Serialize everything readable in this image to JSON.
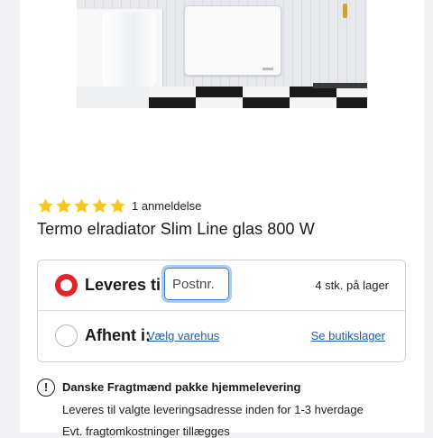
{
  "product": {
    "image_alt": "Termo elradiator Slim Line glas 800 W product photo",
    "rating_stars": 5,
    "review_count": "1 anmeldelse",
    "title": "Termo elradiator Slim Line glas 800 W"
  },
  "delivery": {
    "ship_label": "Leveres til:",
    "postal_placeholder": "Postnr.",
    "postal_value": "",
    "stock_text": "4 stk. på lager",
    "pickup_label": "Afhent i:",
    "choose_warehouse_link": "Vælg varehus",
    "see_stock_link": "Se butikslager",
    "selected_option": "ship"
  },
  "shipping_info": {
    "icon": "info-icon",
    "title": "Danske Fragtmænd pakke hjemmelevering",
    "lines": [
      "Leveres til valgte leveringsadresse inden for 1-3 hverdage",
      "Evt. fragtomkostninger tillægges"
    ]
  },
  "colors": {
    "accent_red": "#e3242b",
    "star_yellow": "#f7c61c",
    "link_blue": "#1d5ba8",
    "focus_blue": "#3b7dc6"
  }
}
